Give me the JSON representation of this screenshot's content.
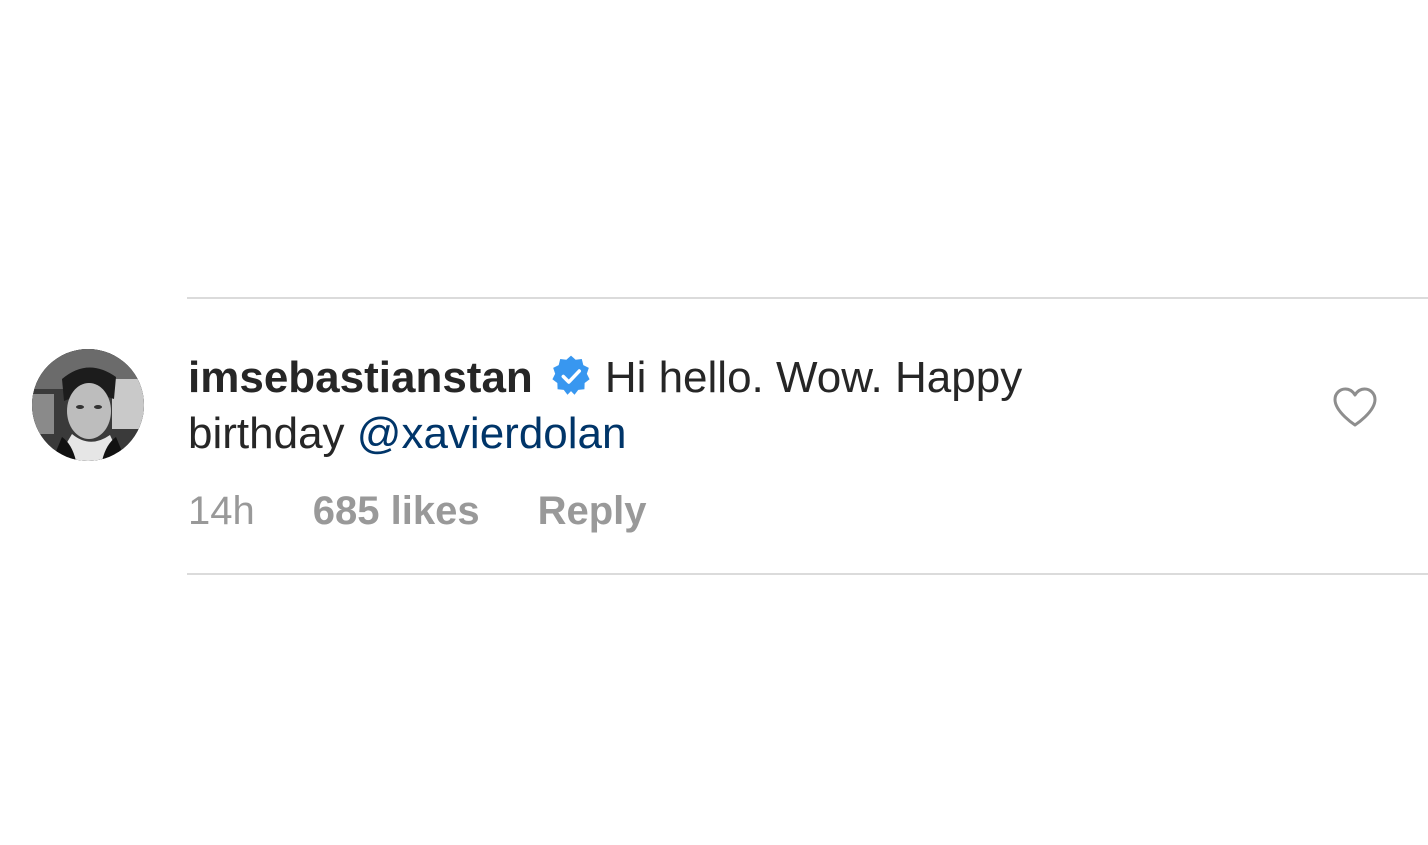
{
  "comment": {
    "username": "imsebastianstan",
    "verified_icon": "verified-badge-icon",
    "text": "Hi hello. Wow. Happy birthday",
    "mention": "@xavierdolan",
    "time": "14h",
    "likes": "685 likes",
    "reply_label": "Reply",
    "like_icon": "heart-outline-icon",
    "avatar": "profile-photo"
  },
  "colors": {
    "text": "#262626",
    "meta": "#999999",
    "mention": "#003569",
    "verified": "#3897f0",
    "divider": "#dbdbdb"
  }
}
